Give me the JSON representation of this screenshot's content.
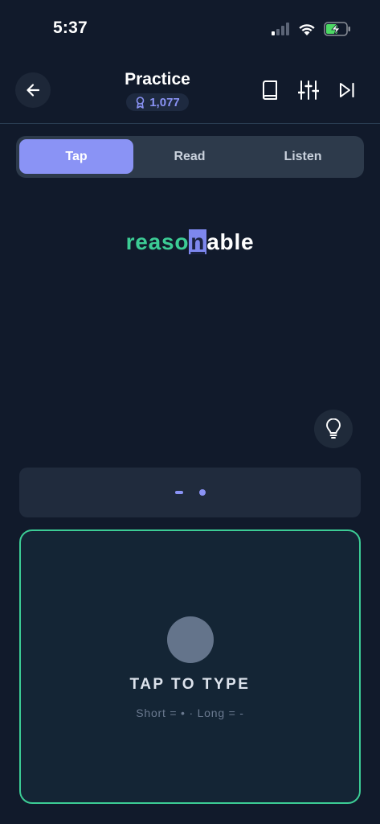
{
  "status_bar": {
    "time": "5:37"
  },
  "header": {
    "title": "Practice",
    "score": "1,077"
  },
  "tabs": [
    {
      "label": "Tap",
      "active": true
    },
    {
      "label": "Read",
      "active": false
    },
    {
      "label": "Listen",
      "active": false
    }
  ],
  "word": {
    "completed": "reaso",
    "current": "n",
    "remaining": "able"
  },
  "morse_pattern": [
    "dash",
    "dot"
  ],
  "tap_pad": {
    "label": "TAP TO TYPE",
    "legend": "Short = • · Long = -"
  },
  "colors": {
    "background": "#111a2b",
    "accent": "#8a93f5",
    "success": "#3ccc95",
    "surface": "#202b3d"
  },
  "icons": {
    "back": "arrow-left-icon",
    "score": "award-icon",
    "dictionary": "book-icon",
    "settings": "sliders-icon",
    "skip": "skip-forward-icon",
    "hint": "lightbulb-icon"
  }
}
